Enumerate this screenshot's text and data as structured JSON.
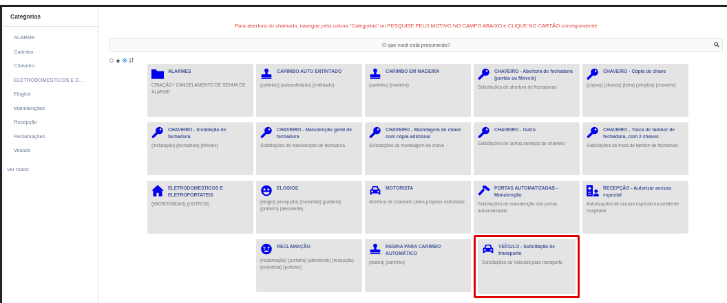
{
  "sidebar": {
    "title": "Categorias",
    "items": [
      {
        "label": "ALARME"
      },
      {
        "label": "Carimbo"
      },
      {
        "label": "Chaveiro"
      },
      {
        "label": "ELETRODOMESTICOS E E..."
      },
      {
        "label": "Elogios"
      },
      {
        "label": "Manutenções"
      },
      {
        "label": "Recepção"
      },
      {
        "label": "Reclamações"
      },
      {
        "label": "Veiculo"
      }
    ],
    "view_all": "Ver todos"
  },
  "notice": "Para abertura do chamado, navegue pela coluna \"Categorias\" ou PESQUISE PELO MOTIVO NO CAMPO ABAIXO e CLIQUE NO CARTÃO correspondente",
  "search": {
    "placeholder": "O que você está procurando?"
  },
  "sort_options": [
    {
      "kind": "star",
      "selected": false
    },
    {
      "kind": "sort",
      "selected": true
    }
  ],
  "cards": [
    {
      "kind": "folder",
      "title": "ALARMES",
      "description": "CRIAÇÃO / CANCELAMENTO DE SENHA DE ALARME",
      "highlighted": false
    },
    {
      "kind": "stamp",
      "title": "CARIMBO AUTO ENTINTADO",
      "description": "(carimbo) (autoentintado) (entintado)",
      "highlighted": false
    },
    {
      "kind": "stamp",
      "title": "CARIMBO EM MADEIRA",
      "description": "(carimbo) (madeira)",
      "highlighted": false
    },
    {
      "kind": "key",
      "title": "CHAVEIRO - Abertura de fechadura (portas ou Móveis)",
      "description": "Solicitações de abertura de fechaduras",
      "highlighted": false
    },
    {
      "kind": "key",
      "title": "CHAVEIRO - Cópia de chave",
      "description": "(cópias) (chaves) (tetra) (simples) (chaveiro)",
      "highlighted": false
    },
    {
      "kind": "key",
      "title": "CHAVEIRO - Instalação de fechadura",
      "description": "(instalação) (fechadura) (blindex)",
      "highlighted": false
    },
    {
      "kind": "key",
      "title": "CHAVEIRO - Manutenção geral de fechadura",
      "description": "Solicitações de manutenção de fechadura",
      "highlighted": false
    },
    {
      "kind": "key",
      "title": "CHAVEIRO - Modelagem de chave com cópia adicional",
      "description": "Solicitações de modelagem de chave",
      "highlighted": false
    },
    {
      "kind": "key",
      "title": "CHAVEIRO - Outro",
      "description": "Solicitações de outros serviços de chaveiro",
      "highlighted": false
    },
    {
      "kind": "key",
      "title": "CHAVEIRO - Troca de tambor de fechadura, com 2 chaves",
      "description": "Solicitações de troca de tambor de fechadura",
      "highlighted": false
    },
    {
      "kind": "house",
      "title": "ELETRODOMESTICOS E ELETROPORTATEIS",
      "description": "(MICROONDAS) (OUTROS)",
      "highlighted": false
    },
    {
      "kind": "smile",
      "title": "ELOGIOS",
      "description": "(elogio) (recepção) (motorista) (portaria) (porteiro) (atendente)",
      "highlighted": false
    },
    {
      "kind": "car",
      "title": "MOTORISTA",
      "description": "Abertura de chamado pelos próprios motoristas",
      "highlighted": false
    },
    {
      "kind": "hammer",
      "title": "PORTAS AUTOMATIZADAS - Manutenção",
      "description": "Solicitações de manutenção nas portas automatizadas",
      "highlighted": false
    },
    {
      "kind": "badge",
      "title": "RECEPÇÃO - Autorizar acesso especial",
      "description": "Autorizações de acesso especial no ambiente hospitalar",
      "highlighted": false
    },
    {
      "kind": "angry",
      "title": "RECLAMAÇÃO",
      "description": "(reclamação) (portaria) (atendente) (recepção) (motorista) (porteiro)",
      "highlighted": false
    },
    {
      "kind": "stamp",
      "title": "RESINA PARA CARIMBO AUTOMÁTICO",
      "description": "(resina) (carimbo)",
      "highlighted": false
    },
    {
      "kind": "car",
      "title": "VEÍCULO - Solicitação de transporte",
      "description": "Solicitações de Veiculos para transporte",
      "highlighted": true
    }
  ]
}
